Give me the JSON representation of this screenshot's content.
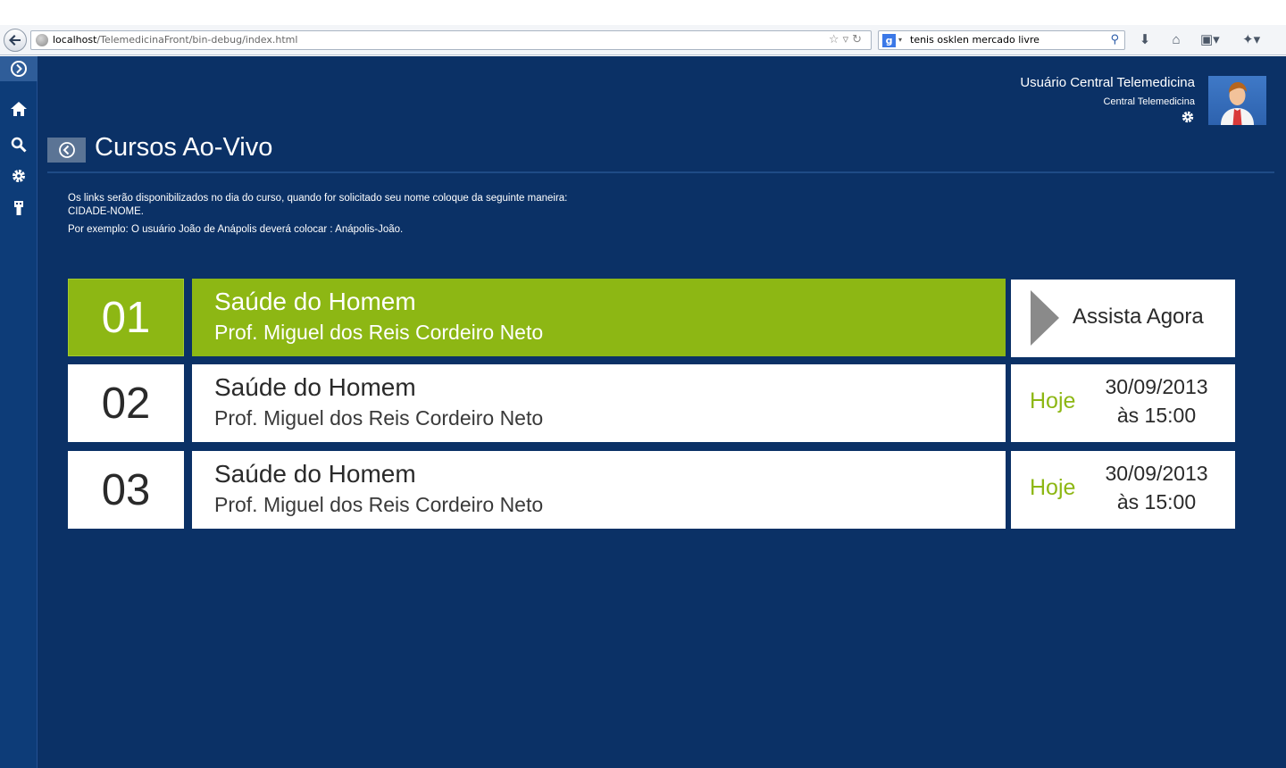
{
  "browser": {
    "url_host": "localhost",
    "url_path": "/TelemedicinaFront/bin-debug/index.html",
    "search_text": "tenis osklen mercado livre",
    "search_engine_icon": "google-icon"
  },
  "sidebar": {
    "items": [
      {
        "icon": "expand-icon"
      },
      {
        "icon": "home-icon"
      },
      {
        "icon": "search-icon"
      },
      {
        "icon": "gear-icon"
      },
      {
        "icon": "usb-icon"
      }
    ]
  },
  "user": {
    "name": "Usuário Central Telemedicina",
    "role": "Central Telemedicina"
  },
  "page": {
    "title": "Cursos Ao-Vivo",
    "info_line1": "Os links serão disponibilizados no dia do curso, quando for solicitado seu nome coloque da seguinte maneira:",
    "info_line2": "CIDADE-NOME.",
    "info_line3": "Por exemplo: O usuário João de Anápolis deverá colocar : Anápolis-João."
  },
  "courses": [
    {
      "number": "01",
      "title": "Saúde do Homem",
      "professor": "Prof. Miguel dos Reis Cordeiro Neto",
      "action": "Assista Agora"
    },
    {
      "number": "02",
      "title": "Saúde do Homem",
      "professor": "Prof. Miguel dos Reis Cordeiro Neto",
      "day": "Hoje",
      "date": "30/09/2013",
      "time": "às 15:00"
    },
    {
      "number": "03",
      "title": "Saúde do Homem",
      "professor": "Prof. Miguel dos Reis Cordeiro Neto",
      "day": "Hoje",
      "date": "30/09/2013",
      "time": "às 15:00"
    }
  ],
  "colors": {
    "background": "#0b3166",
    "sidebar": "#0d3c78",
    "accent_green": "#8db714"
  }
}
